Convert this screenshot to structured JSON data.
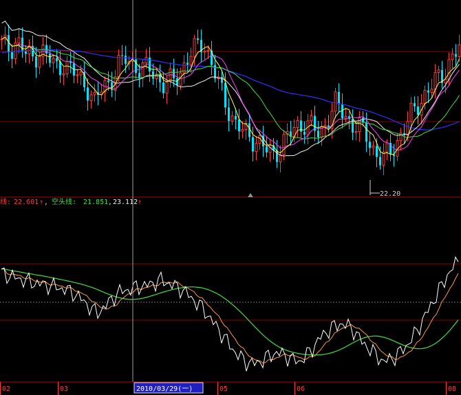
{
  "colors": {
    "background": "#000000",
    "up": "#ff3b3b",
    "down": "#00e5ff",
    "ma_white": "#f0f0f0",
    "ma_yellow": "#ffff40",
    "ma_magenta": "#ff40ff",
    "ma_green": "#40e040",
    "ma_blue": "#3030ff",
    "grid_red": "#8a0000",
    "osc_white": "#ffffff",
    "osc_orange": "#ff9a3a",
    "osc_green": "#40e040",
    "crosshair": "#a0a0a0",
    "axis_text": "#ff3b3b",
    "date_box_bg": "#2020c0",
    "date_box_text": "#ffffff"
  },
  "indicator_bar": {
    "prefix": "线:",
    "value1": "22.601",
    "arrow1": "↑",
    "sep1": ",",
    "label2": "空头线:",
    "value2": "21.851",
    "sep2": ",",
    "value3": "23.112",
    "arrow3": "↑"
  },
  "low_marker": "22.20",
  "cursor_date": "2010/03/29(一)",
  "x_axis_labels": [
    "02",
    "03",
    "05",
    "06",
    "08"
  ],
  "chart_data": [
    {
      "type": "candlestick",
      "low_label": "22.20",
      "close_trace": [
        24.9,
        24.8,
        25.0,
        24.7,
        24.6,
        24.8,
        24.6,
        24.4,
        24.5,
        24.3,
        24.2,
        24.0,
        23.6,
        24.0,
        24.1,
        24.4,
        24.6,
        24.5,
        24.3,
        24.4,
        24.2,
        24.0,
        24.1,
        24.3,
        24.6,
        24.8,
        25.0,
        24.5,
        24.0,
        23.6,
        23.2,
        23.0,
        22.9,
        22.8,
        22.6,
        22.5,
        22.7,
        22.9,
        23.1,
        23.2,
        23.1,
        22.9,
        23.3,
        23.6,
        23.4,
        23.2,
        23.1,
        22.9,
        22.6,
        22.4,
        22.5,
        22.8,
        23.1,
        23.4,
        23.7,
        23.9,
        24.1,
        24.3,
        24.6,
        24.8
      ]
    },
    {
      "type": "line",
      "series_trace": [
        0.62,
        0.58,
        0.55,
        0.52,
        0.5,
        0.48,
        0.45,
        0.4,
        0.3,
        0.2,
        0.3,
        0.42,
        0.45,
        0.48,
        0.5,
        0.55,
        0.5,
        0.45,
        0.35,
        0.25,
        0.1,
        -0.05,
        -0.2,
        -0.3,
        -0.32,
        -0.25,
        -0.2,
        -0.25,
        -0.3,
        -0.2,
        -0.05,
        0.05,
        0.1,
        0.05,
        -0.1,
        -0.2,
        -0.3,
        -0.25,
        -0.15,
        0.0,
        0.2,
        0.4,
        0.6,
        0.75
      ]
    }
  ]
}
